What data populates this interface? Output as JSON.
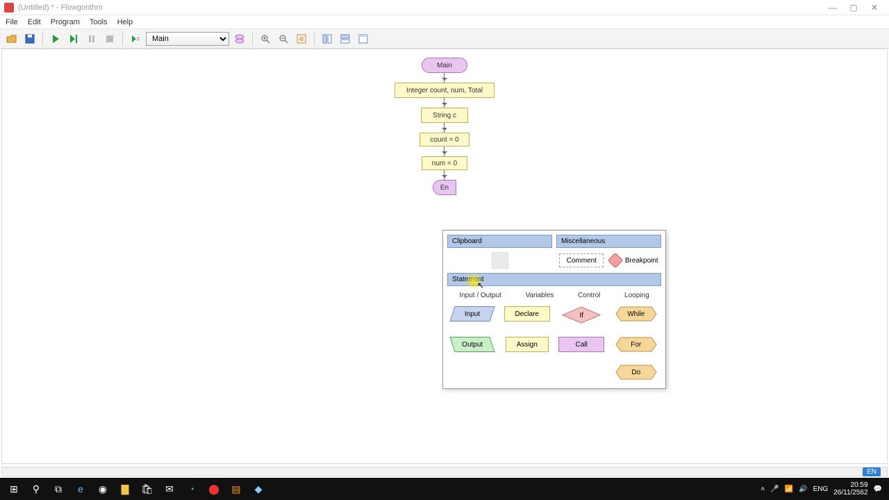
{
  "titlebar": {
    "text": "(Untitled) * - Flowgorithm"
  },
  "menubar": {
    "file": "File",
    "edit": "Edit",
    "program": "Program",
    "tools": "Tools",
    "help": "Help"
  },
  "toolbar": {
    "func": "Main"
  },
  "flow": {
    "start": "Main",
    "n1": "Integer count, num, Total",
    "n2": "String c",
    "n3": "count = 0",
    "n4": "num = 0",
    "end_partial": "En"
  },
  "popup": {
    "clipboard": "Clipboard",
    "misc": "Miscellaneous",
    "comment": "Comment",
    "breakpoint": "Breakpoint",
    "statement": "Statement",
    "cat_io": "Input / Output",
    "cat_vars": "Variables",
    "cat_ctrl": "Control",
    "cat_loop": "Looping",
    "input": "Input",
    "declare": "Declare",
    "if": "If",
    "while": "While",
    "output": "Output",
    "assign": "Assign",
    "call": "Call",
    "for": "For",
    "do": "Do"
  },
  "taskbar": {
    "lang": "ENG",
    "time": "20:59",
    "date": "26/11/2562",
    "badge": "EN"
  }
}
